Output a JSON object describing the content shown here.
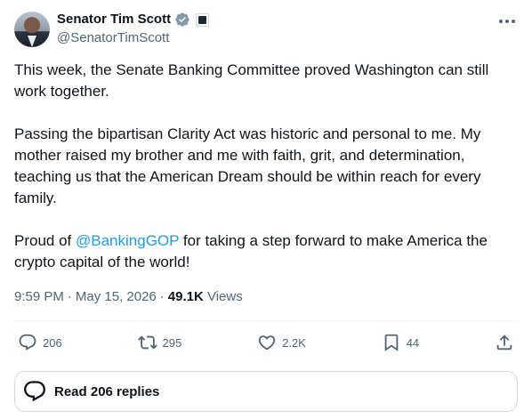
{
  "author": {
    "display_name": "Senator Tim Scott",
    "handle": "@SenatorTimScott",
    "verified": true,
    "accent_color": "#1d9bf0"
  },
  "tweet": {
    "paragraph_1": "This week, the Senate Banking Committee proved Washington can still work together.",
    "paragraph_2": "Passing the bipartisan Clarity Act was historic and personal to me. My mother raised my brother and me with faith, grit, and determination, teaching us that the American Dream should be within reach for every family.",
    "paragraph_3_before": "Proud of ",
    "mention": "@BankingGOP",
    "paragraph_3_after": " for taking a step forward to make America the crypto capital of the world!"
  },
  "meta": {
    "time": "9:59 PM",
    "separator_1": "·",
    "date": "May 15, 2026",
    "separator_2": "·",
    "views_count": "49.1K",
    "views_label": "Views"
  },
  "actions": {
    "replies": {
      "icon": "reply-icon",
      "count": "206"
    },
    "reposts": {
      "icon": "repost-icon",
      "count": "295"
    },
    "likes": {
      "icon": "like-icon",
      "count": "2.2K"
    },
    "bookmarks": {
      "icon": "bookmark-icon",
      "count": "44"
    },
    "share": {
      "icon": "share-icon"
    }
  },
  "read_replies": {
    "icon": "reply-bubble-icon",
    "label": "Read 206 replies"
  }
}
